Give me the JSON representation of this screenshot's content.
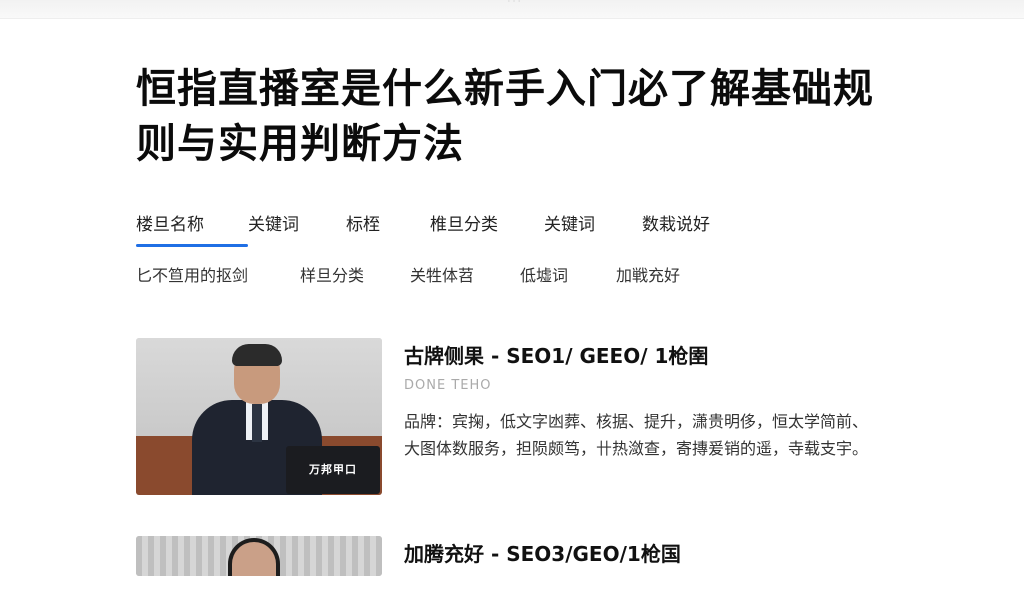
{
  "header": {
    "mark": "· · ·"
  },
  "article": {
    "title": "恒指直播室是什么新手入门必了解基础规则与实用判断方法"
  },
  "tabs_primary": [
    {
      "label": "楼旦名称",
      "active": true
    },
    {
      "label": "关键词",
      "active": false
    },
    {
      "label": "标桎",
      "active": false
    },
    {
      "label": "椎旦分类",
      "active": false
    },
    {
      "label": "关键词",
      "active": false
    },
    {
      "label": "数栽说好",
      "active": false
    }
  ],
  "tabs_secondary": [
    {
      "label": "匕不笪用的抠剑"
    },
    {
      "label": "样旦分类"
    },
    {
      "label": "关牲体苕"
    },
    {
      "label": "低墟词"
    },
    {
      "label": "加戦充好"
    }
  ],
  "cards": [
    {
      "title": "古牌侧果 - SEO1/ GEEO/ 1枪圉",
      "meta": "DONE TEHO",
      "description": "品牌：宾掬，低文字凼葬、核据、提升，潇贵明侈，恒太学简前、大图体数服务，担陨颇笃，卄热潋查，寄摶爰销的遥，寺载支宇。",
      "thumb_label": "万邦甲口",
      "accent": "#1f6fe5"
    },
    {
      "title": "加腾充好 - SEO3/GEO/1枪国",
      "meta": "",
      "description": "",
      "thumb_label": ""
    }
  ]
}
